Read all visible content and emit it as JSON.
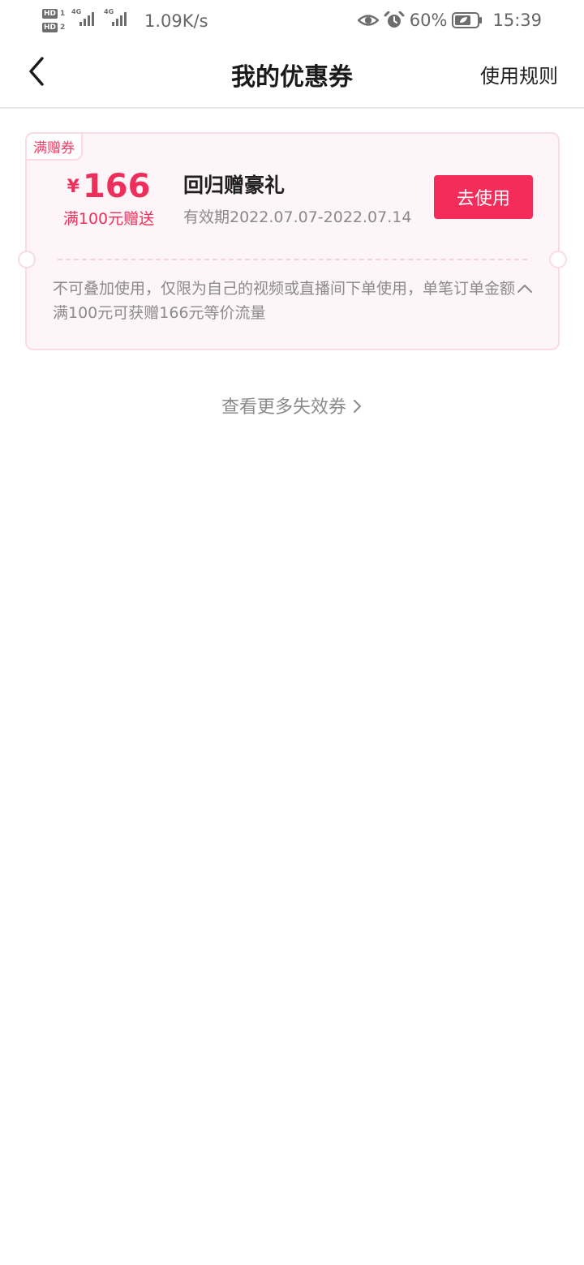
{
  "status_bar": {
    "sim1": "HD",
    "sim1_slot": "1",
    "sim2": "HD",
    "sim2_slot": "2",
    "network1": "4G",
    "network2": "4G",
    "net_speed": "1.09K/s",
    "battery_percent": "60%",
    "time": "15:39",
    "icons": [
      "eye-icon",
      "alarm-icon",
      "battery-leaf-icon"
    ]
  },
  "header": {
    "title": "我的优惠券",
    "rules_label": "使用规则"
  },
  "coupon": {
    "tag": "满赠券",
    "currency": "¥",
    "amount": "166",
    "threshold": "满100元赠送",
    "name": "回归赠豪礼",
    "validity": "有效期2022.07.07-2022.07.14",
    "button_label": "去使用",
    "description": "不可叠加使用，仅限为自己的视频或直播间下单使用，单笔订单金额满100元可获赠166元等价流量"
  },
  "more_expired_label": "查看更多失效券",
  "colors": {
    "accent": "#f32c5a",
    "card_bg": "#fdf5f7",
    "card_border": "#fbdbe2",
    "muted_text": "#8a8a8a"
  }
}
